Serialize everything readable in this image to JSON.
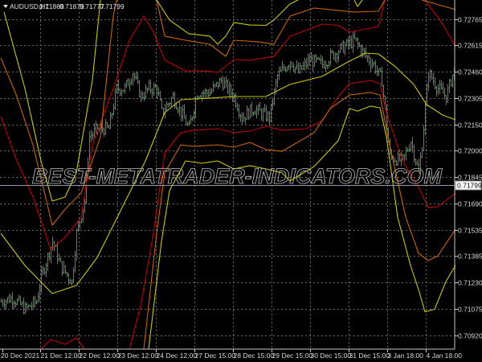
{
  "header": {
    "symbol": "AUDUSD,H1",
    "open": "0.71869",
    "high": "0.71879",
    "low": "0.71777",
    "close": "0.71799"
  },
  "watermark": "BEST-METATRADER-INDICATORS.COM",
  "colors": {
    "background": "#000000",
    "candles": "#1fae1f",
    "grid": "#6a6a6a",
    "mid": "#c8c800",
    "inner": "#c00000",
    "middle": "#c86400",
    "outer": "#c8c800"
  },
  "chart_data": {
    "type": "line",
    "title": "AUDUSD,H1",
    "ylim": [
      0.70838,
      0.72878
    ],
    "xlim": [
      0,
      283
    ],
    "x_unit": "bar index",
    "grid": true,
    "current_price": "0.71799",
    "y_ticks": [
      "0.72765",
      "0.72615",
      "0.72460",
      "0.72305",
      "0.72150",
      "0.72000",
      "0.71845",
      "0.71690",
      "0.71535",
      "0.71385",
      "0.71230",
      "0.71075",
      "0.70920"
    ],
    "x_ticks": [
      {
        "bar": 1,
        "label": "20 Dec 2021"
      },
      {
        "bar": 24.5,
        "label": "21 Dec 12:00"
      },
      {
        "bar": 48.5,
        "label": "22 Dec 12:00"
      },
      {
        "bar": 72.5,
        "label": "23 Dec 12:00"
      },
      {
        "bar": 96.5,
        "label": "24 Dec 12:00"
      },
      {
        "bar": 120.5,
        "label": "27 Dec 15:00"
      },
      {
        "bar": 144.5,
        "label": "28 Dec 15:00"
      },
      {
        "bar": 168.5,
        "label": "29 Dec 15:00"
      },
      {
        "bar": 192.5,
        "label": "30 Dec 15:00"
      },
      {
        "bar": 216.5,
        "label": "31 Dec 15:00"
      },
      {
        "bar": 240.5,
        "label": "3 Jan 18:00"
      },
      {
        "bar": 264.5,
        "label": "4 Jan 18:00"
      }
    ],
    "price_path": [
      [
        0,
        0.71116
      ],
      [
        7,
        0.71139
      ],
      [
        15,
        0.71071
      ],
      [
        22,
        0.71116
      ],
      [
        25,
        0.71257
      ],
      [
        32,
        0.71468
      ],
      [
        37,
        0.71327
      ],
      [
        44,
        0.71233
      ],
      [
        47,
        0.71515
      ],
      [
        52,
        0.71703
      ],
      [
        55,
        0.72079
      ],
      [
        60,
        0.72126
      ],
      [
        67,
        0.72126
      ],
      [
        72,
        0.72361
      ],
      [
        77,
        0.72361
      ],
      [
        82,
        0.72455
      ],
      [
        87,
        0.72314
      ],
      [
        92,
        0.72361
      ],
      [
        97,
        0.72361
      ],
      [
        100,
        0.7222
      ],
      [
        107,
        0.72314
      ],
      [
        112,
        0.7222
      ],
      [
        117,
        0.72126
      ],
      [
        122,
        0.72338
      ],
      [
        130,
        0.72338
      ],
      [
        137,
        0.72408
      ],
      [
        145,
        0.72314
      ],
      [
        150,
        0.72191
      ],
      [
        157,
        0.72244
      ],
      [
        167,
        0.72191
      ],
      [
        172,
        0.72432
      ],
      [
        180,
        0.72526
      ],
      [
        185,
        0.72455
      ],
      [
        192,
        0.72526
      ],
      [
        200,
        0.72502
      ],
      [
        205,
        0.72549
      ],
      [
        212,
        0.72596
      ],
      [
        220,
        0.72643
      ],
      [
        227,
        0.72549
      ],
      [
        232,
        0.72502
      ],
      [
        237,
        0.72408
      ],
      [
        242,
        0.71962
      ],
      [
        250,
        0.71938
      ],
      [
        255,
        0.72056
      ],
      [
        260,
        0.71868
      ],
      [
        262,
        0.72032
      ],
      [
        266,
        0.72455
      ],
      [
        272,
        0.72361
      ],
      [
        277,
        0.72314
      ],
      [
        283,
        0.72502
      ]
    ],
    "series": [
      {
        "name": "mid",
        "color_key": "mid",
        "segments": [
          [
            [
              0,
              0.71515
            ],
            [
              15,
              0.71327
            ],
            [
              32,
              0.71163
            ],
            [
              47,
              0.7121
            ],
            [
              60,
              0.71374
            ],
            [
              75,
              0.71656
            ],
            [
              90,
              0.71938
            ],
            [
              102,
              0.7222
            ],
            [
              112,
              0.72295
            ],
            [
              130,
              0.72305
            ],
            [
              145,
              0.72314
            ],
            [
              165,
              0.72314
            ],
            [
              180,
              0.72385
            ],
            [
              200,
              0.72432
            ],
            [
              215,
              0.72511
            ],
            [
              227,
              0.72568
            ],
            [
              235,
              0.72563
            ],
            [
              245,
              0.72493
            ],
            [
              257,
              0.72385
            ],
            [
              265,
              0.72267
            ],
            [
              275,
              0.72206
            ],
            [
              283,
              0.72178
            ]
          ]
        ]
      },
      {
        "name": "upper-inner",
        "color_key": "inner",
        "segments": [
          [
            [
              0,
              0.72197
            ],
            [
              10,
              0.71938
            ],
            [
              20,
              0.71727
            ],
            [
              31,
              0.71421
            ],
            [
              40,
              0.71492
            ],
            [
              50,
              0.71609
            ],
            [
              57,
              0.72032
            ],
            [
              70,
              0.72361
            ],
            [
              80,
              0.72643
            ],
            [
              89,
              0.72784
            ],
            [
              95,
              0.7269
            ],
            [
              102,
              0.72526
            ],
            [
              115,
              0.72464
            ],
            [
              127,
              0.72464
            ],
            [
              135,
              0.72455
            ],
            [
              145,
              0.7253
            ],
            [
              155,
              0.72526
            ],
            [
              170,
              0.72549
            ],
            [
              180,
              0.72667
            ],
            [
              200,
              0.72737
            ],
            [
              210,
              0.7273
            ],
            [
              217,
              0.7269
            ],
            [
              235,
              0.72723
            ],
            [
              239,
              0.72878
            ]
          ],
          [
            [
              264,
              0.72878
            ],
            [
              275,
              0.72737
            ],
            [
              283,
              0.72605
            ]
          ]
        ]
      },
      {
        "name": "upper-middle",
        "color_key": "middle",
        "segments": [
          [
            [
              0,
              0.7254
            ],
            [
              10,
              0.72314
            ],
            [
              20,
              0.72032
            ],
            [
              32,
              0.71562
            ],
            [
              40,
              0.71656
            ],
            [
              50,
              0.7175
            ],
            [
              62,
              0.72079
            ],
            [
              70,
              0.72784
            ],
            [
              72,
              0.72878
            ]
          ],
          [
            [
              97,
              0.72878
            ],
            [
              102,
              0.72667
            ],
            [
              115,
              0.72643
            ],
            [
              130,
              0.7262
            ],
            [
              140,
              0.72549
            ],
            [
              145,
              0.72643
            ],
            [
              160,
              0.72634
            ],
            [
              170,
              0.7262
            ],
            [
              180,
              0.72784
            ],
            [
              195,
              0.72831
            ],
            [
              220,
              0.72808
            ],
            [
              235,
              0.72812
            ],
            [
              239,
              0.72878
            ]
          ],
          [
            [
              262,
              0.72878
            ],
            [
              283,
              0.72822
            ]
          ]
        ]
      },
      {
        "name": "upper-outer",
        "color_key": "outer",
        "segments": [
          [
            [
              2,
              0.72808
            ],
            [
              15,
              0.72361
            ],
            [
              25,
              0.71938
            ],
            [
              32,
              0.71703
            ],
            [
              40,
              0.71727
            ],
            [
              47,
              0.71868
            ],
            [
              57,
              0.72408
            ],
            [
              62,
              0.72878
            ]
          ],
          [
            [
              97,
              0.72878
            ],
            [
              105,
              0.72761
            ],
            [
              117,
              0.72681
            ],
            [
              130,
              0.72667
            ],
            [
              135,
              0.7262
            ],
            [
              140,
              0.72667
            ],
            [
              145,
              0.72746
            ],
            [
              155,
              0.72732
            ],
            [
              165,
              0.7273
            ],
            [
              170,
              0.72761
            ],
            [
              180,
              0.72855
            ],
            [
              185,
              0.72878
            ]
          ],
          [
            [
              220,
              0.72878
            ],
            [
              222,
              0.7284
            ],
            [
              225,
              0.72878
            ]
          ]
        ]
      },
      {
        "name": "lower-inner",
        "color_key": "inner",
        "segments": [
          [
            [
              25,
              0.70838
            ],
            [
              31,
              0.70895
            ],
            [
              40,
              0.70866
            ],
            [
              47,
              0.70904
            ],
            [
              52,
              0.70838
            ]
          ],
          [
            [
              80,
              0.70838
            ],
            [
              87,
              0.71092
            ],
            [
              95,
              0.71515
            ],
            [
              102,
              0.71985
            ],
            [
              112,
              0.72103
            ],
            [
              120,
              0.72117
            ],
            [
              135,
              0.72126
            ],
            [
              145,
              0.72103
            ],
            [
              155,
              0.72112
            ],
            [
              165,
              0.7214
            ],
            [
              175,
              0.72117
            ],
            [
              190,
              0.72126
            ],
            [
              200,
              0.72173
            ],
            [
              210,
              0.72314
            ],
            [
              217,
              0.72389
            ],
            [
              230,
              0.72408
            ],
            [
              236,
              0.72389
            ],
            [
              240,
              0.7222
            ],
            [
              250,
              0.71938
            ],
            [
              260,
              0.71783
            ],
            [
              266,
              0.71665
            ],
            [
              272,
              0.7167
            ],
            [
              283,
              0.7175
            ]
          ]
        ]
      },
      {
        "name": "lower-middle",
        "color_key": "middle",
        "segments": [
          [
            [
              89,
              0.70838
            ],
            [
              97,
              0.71515
            ],
            [
              102,
              0.71868
            ],
            [
              112,
              0.72032
            ],
            [
              120,
              0.72023
            ],
            [
              135,
              0.72032
            ],
            [
              145,
              0.72018
            ],
            [
              155,
              0.72046
            ],
            [
              165,
              0.72004
            ],
            [
              175,
              0.71994
            ],
            [
              195,
              0.72103
            ],
            [
              205,
              0.72244
            ],
            [
              217,
              0.72323
            ],
            [
              230,
              0.72338
            ],
            [
              236,
              0.72323
            ],
            [
              242,
              0.72032
            ],
            [
              252,
              0.71609
            ],
            [
              260,
              0.71398
            ],
            [
              266,
              0.71355
            ],
            [
              272,
              0.71383
            ],
            [
              283,
              0.71539
            ]
          ]
        ]
      },
      {
        "name": "lower-outer",
        "color_key": "outer",
        "segments": [
          [
            [
              92,
              0.70838
            ],
            [
              100,
              0.71468
            ],
            [
              105,
              0.71764
            ],
            [
              115,
              0.71938
            ],
            [
              125,
              0.71924
            ],
            [
              135,
              0.71938
            ],
            [
              145,
              0.71891
            ],
            [
              155,
              0.7191
            ],
            [
              165,
              0.71891
            ],
            [
              175,
              0.71868
            ],
            [
              180,
              0.71821
            ],
            [
              195,
              0.71905
            ],
            [
              210,
              0.72056
            ],
            [
              217,
              0.72244
            ],
            [
              222,
              0.72229
            ],
            [
              230,
              0.72258
            ],
            [
              236,
              0.72248
            ],
            [
              240,
              0.72079
            ],
            [
              247,
              0.71609
            ],
            [
              255,
              0.71327
            ],
            [
              260,
              0.71186
            ],
            [
              264,
              0.71056
            ],
            [
              270,
              0.71071
            ],
            [
              277,
              0.71233
            ],
            [
              283,
              0.71327
            ]
          ]
        ]
      }
    ]
  }
}
